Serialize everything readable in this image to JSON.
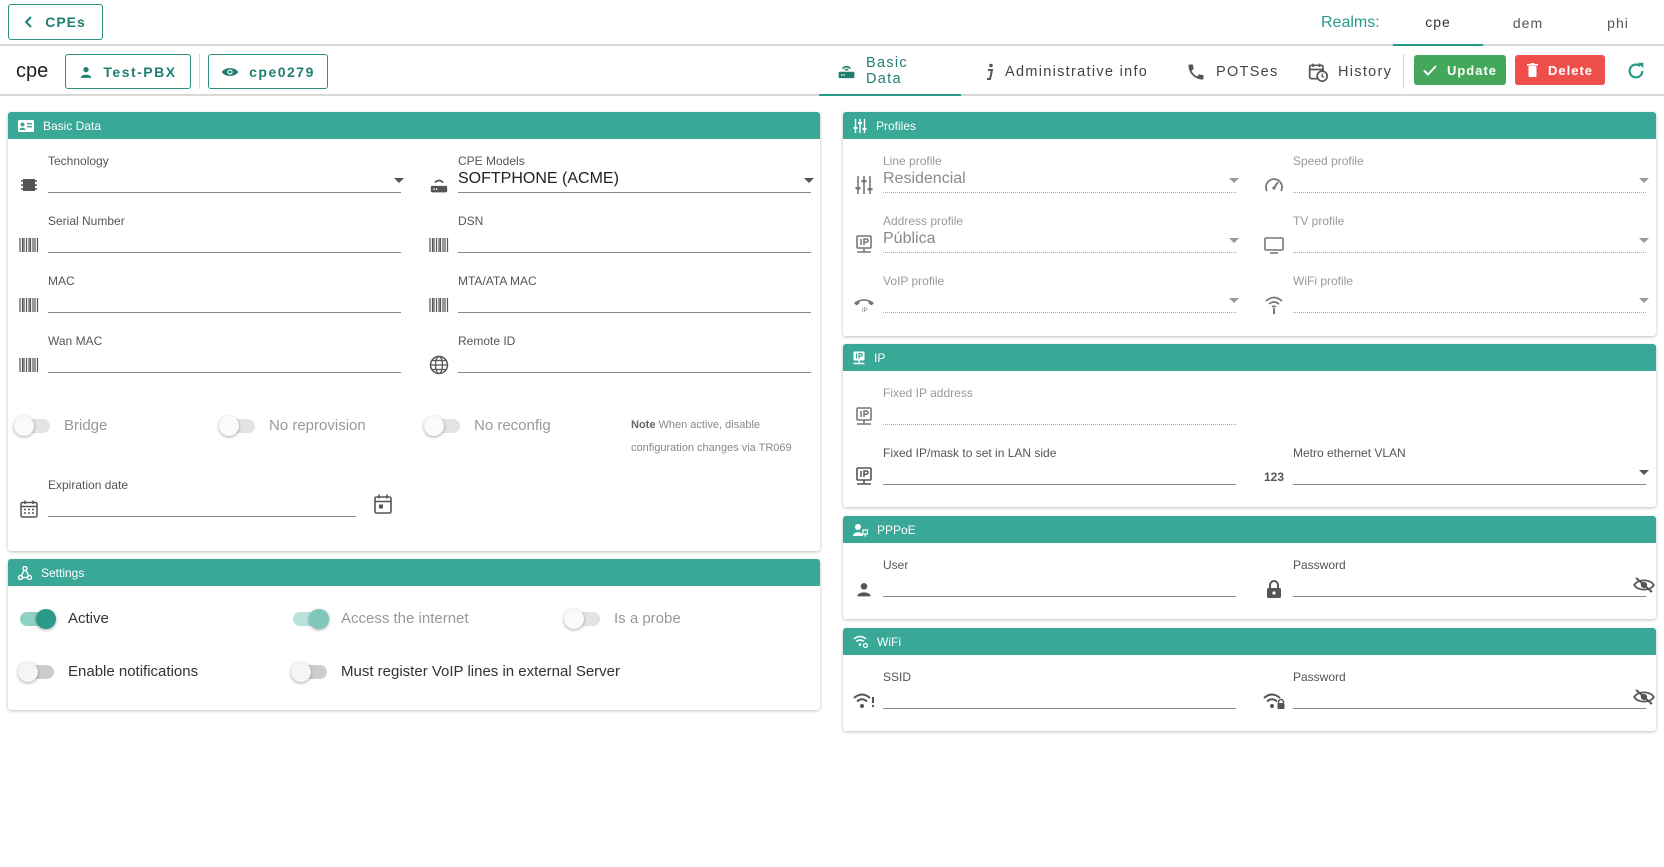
{
  "topbar": {
    "back_label": "CPEs",
    "realms_label": "Realms:",
    "realms": [
      "cpe",
      "dem",
      "phi"
    ],
    "active_realm": "cpe"
  },
  "subbar": {
    "title": "cpe",
    "customer_button": "Test-PBX",
    "device_button": "cpe0279",
    "tabs": [
      "Basic Data",
      "Administrative info",
      "POTSes",
      "History"
    ],
    "active_tab": "Basic Data",
    "update_label": "Update",
    "delete_label": "Delete"
  },
  "basic_data": {
    "header": "Basic Data",
    "technology": {
      "label": "Technology",
      "value": ""
    },
    "cpe_models": {
      "label": "CPE Models",
      "value": "SOFTPHONE (ACME)"
    },
    "serial_number": {
      "label": "Serial Number",
      "value": ""
    },
    "dsn": {
      "label": "DSN",
      "value": ""
    },
    "mac": {
      "label": "MAC",
      "value": ""
    },
    "mta_mac": {
      "label": "MTA/ATA MAC",
      "value": ""
    },
    "wan_mac": {
      "label": "Wan MAC",
      "value": ""
    },
    "remote_id": {
      "label": "Remote ID",
      "value": ""
    },
    "toggles": [
      {
        "label": "Bridge",
        "on": false
      },
      {
        "label": "No reprovision",
        "on": false
      },
      {
        "label": "No reconfig",
        "on": false
      }
    ],
    "note_title": "Note",
    "note_text": "When active, disable configuration changes via TR069",
    "expiration_date": {
      "label": "Expiration date",
      "value": ""
    }
  },
  "settings": {
    "header": "Settings",
    "toggles": [
      {
        "label": "Active",
        "on": true,
        "disabled": false
      },
      {
        "label": "Access the internet",
        "on": true,
        "disabled": true
      },
      {
        "label": "Is a probe",
        "on": false,
        "disabled": true
      },
      {
        "label": "Enable notifications",
        "on": false,
        "disabled": false
      },
      {
        "label": "Must register VoIP lines in external Server",
        "on": false,
        "disabled": false
      }
    ]
  },
  "profiles": {
    "header": "Profiles",
    "line_profile": {
      "label": "Line profile",
      "value": "Residencial"
    },
    "speed_profile": {
      "label": "Speed profile",
      "value": ""
    },
    "address_profile": {
      "label": "Address profile",
      "value": "Pública"
    },
    "tv_profile": {
      "label": "TV profile",
      "value": ""
    },
    "voip_profile": {
      "label": "VoIP profile",
      "value": ""
    },
    "wifi_profile": {
      "label": "WiFi profile",
      "value": ""
    }
  },
  "ip": {
    "header": "IP",
    "fixed_ip": {
      "label": "Fixed IP address",
      "value": ""
    },
    "fixed_ip_lan": {
      "label": "Fixed IP/mask to set in LAN side",
      "value": ""
    },
    "metro_vlan": {
      "label": "Metro ethernet VLAN",
      "value": ""
    },
    "vlan_icon_text": "123"
  },
  "pppoe": {
    "header": "PPPoE",
    "user": {
      "label": "User",
      "value": ""
    },
    "password": {
      "label": "Password",
      "value": ""
    }
  },
  "wifi": {
    "header": "WiFi",
    "ssid": {
      "label": "SSID",
      "value": ""
    },
    "password": {
      "label": "Password",
      "value": ""
    }
  },
  "colors": {
    "accent": "#3aa897",
    "update": "#43a85a",
    "delete": "#ef4f4a"
  }
}
